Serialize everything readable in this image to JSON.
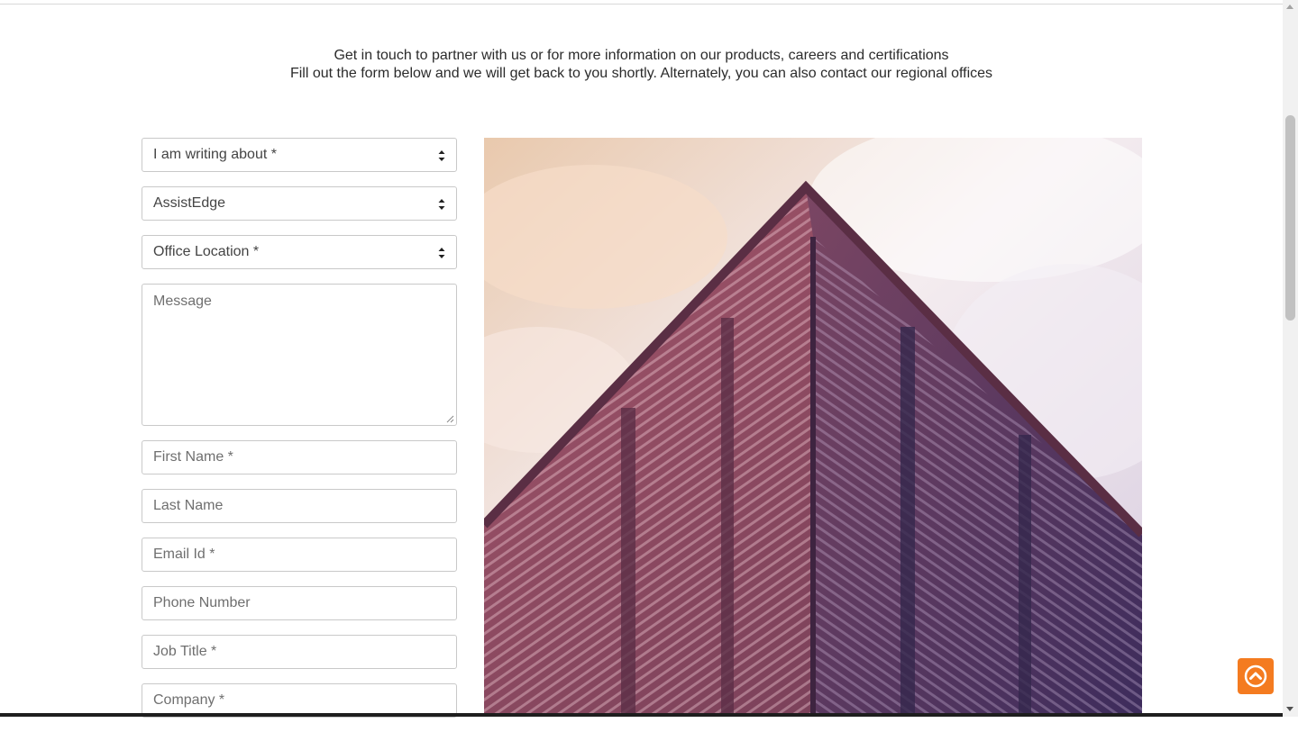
{
  "intro": {
    "line1": "Get in touch to partner with us or for more information on our products, careers and certifications",
    "line2": "Fill out the form below and we will get back to you shortly. Alternately, you can also contact our regional offices"
  },
  "form": {
    "topic_select": "I am writing about *",
    "product_select": "AssistEdge",
    "location_select": "Office Location *",
    "message_placeholder": "Message",
    "first_name_placeholder": "First Name *",
    "last_name_placeholder": "Last Name",
    "email_placeholder": "Email Id *",
    "phone_placeholder": "Phone Number",
    "job_title_placeholder": "Job Title *",
    "company_placeholder": "Company *"
  },
  "colors": {
    "accent": "#f47b20",
    "building": "#6b3a5c",
    "sky": "#f1e3e4"
  },
  "icons": {
    "select_arrows": "select-arrows-icon",
    "scroll_top": "arrow-up-circle-icon"
  }
}
